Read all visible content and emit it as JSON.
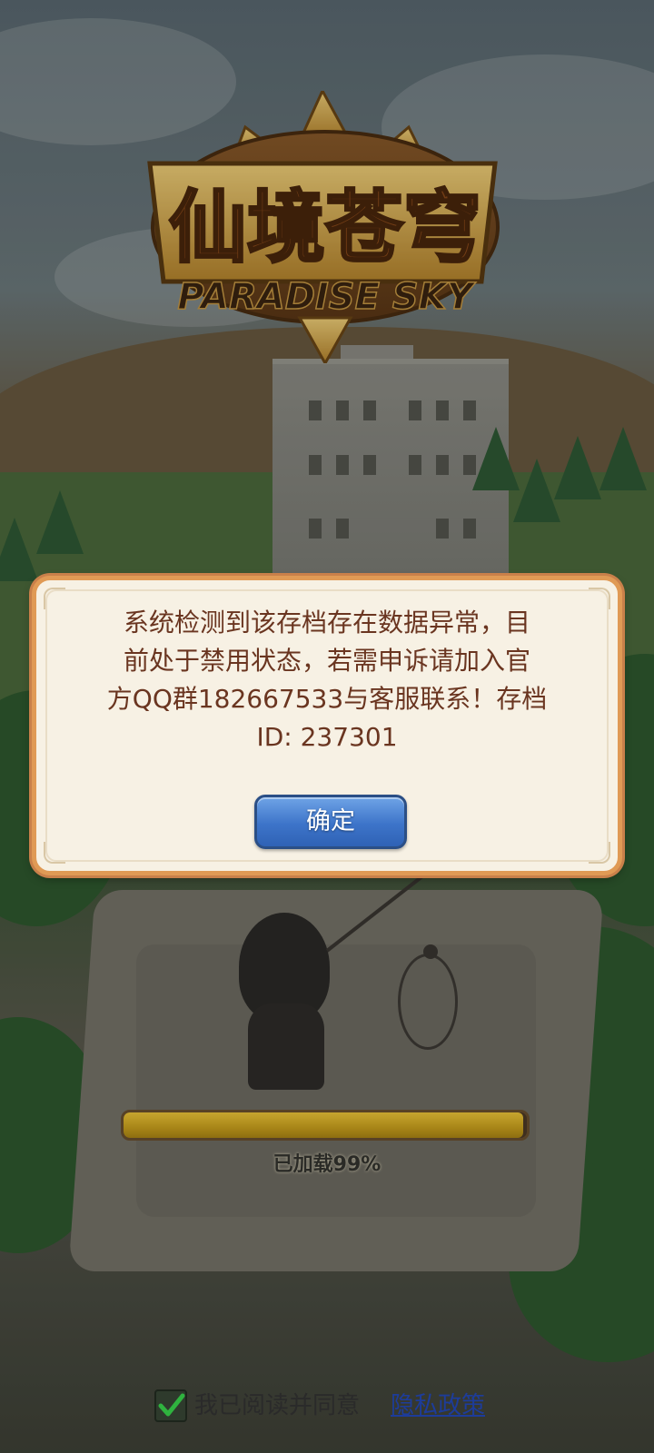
{
  "game": {
    "logo_title": "仙境苍穹",
    "logo_subtitle": "PARADISE SKY"
  },
  "dialog": {
    "message_lines": [
      "系统检测到该存档存在数据异常，目",
      "前处于禁用状态，若需申诉请加入官",
      "方QQ群182667533与客服联系！存档",
      "ID: 237301"
    ],
    "confirm_label": "确定"
  },
  "loading": {
    "progress": 0.99,
    "text": "已加载99%"
  },
  "agreement": {
    "checked": true,
    "label": "我已阅读并同意",
    "link_text": "隐私政策"
  },
  "colors": {
    "dialog_text": "#6a3520",
    "button_blue": "#3d74c9",
    "check_green": "#2fb33f",
    "link_blue": "#1d3c9a"
  }
}
